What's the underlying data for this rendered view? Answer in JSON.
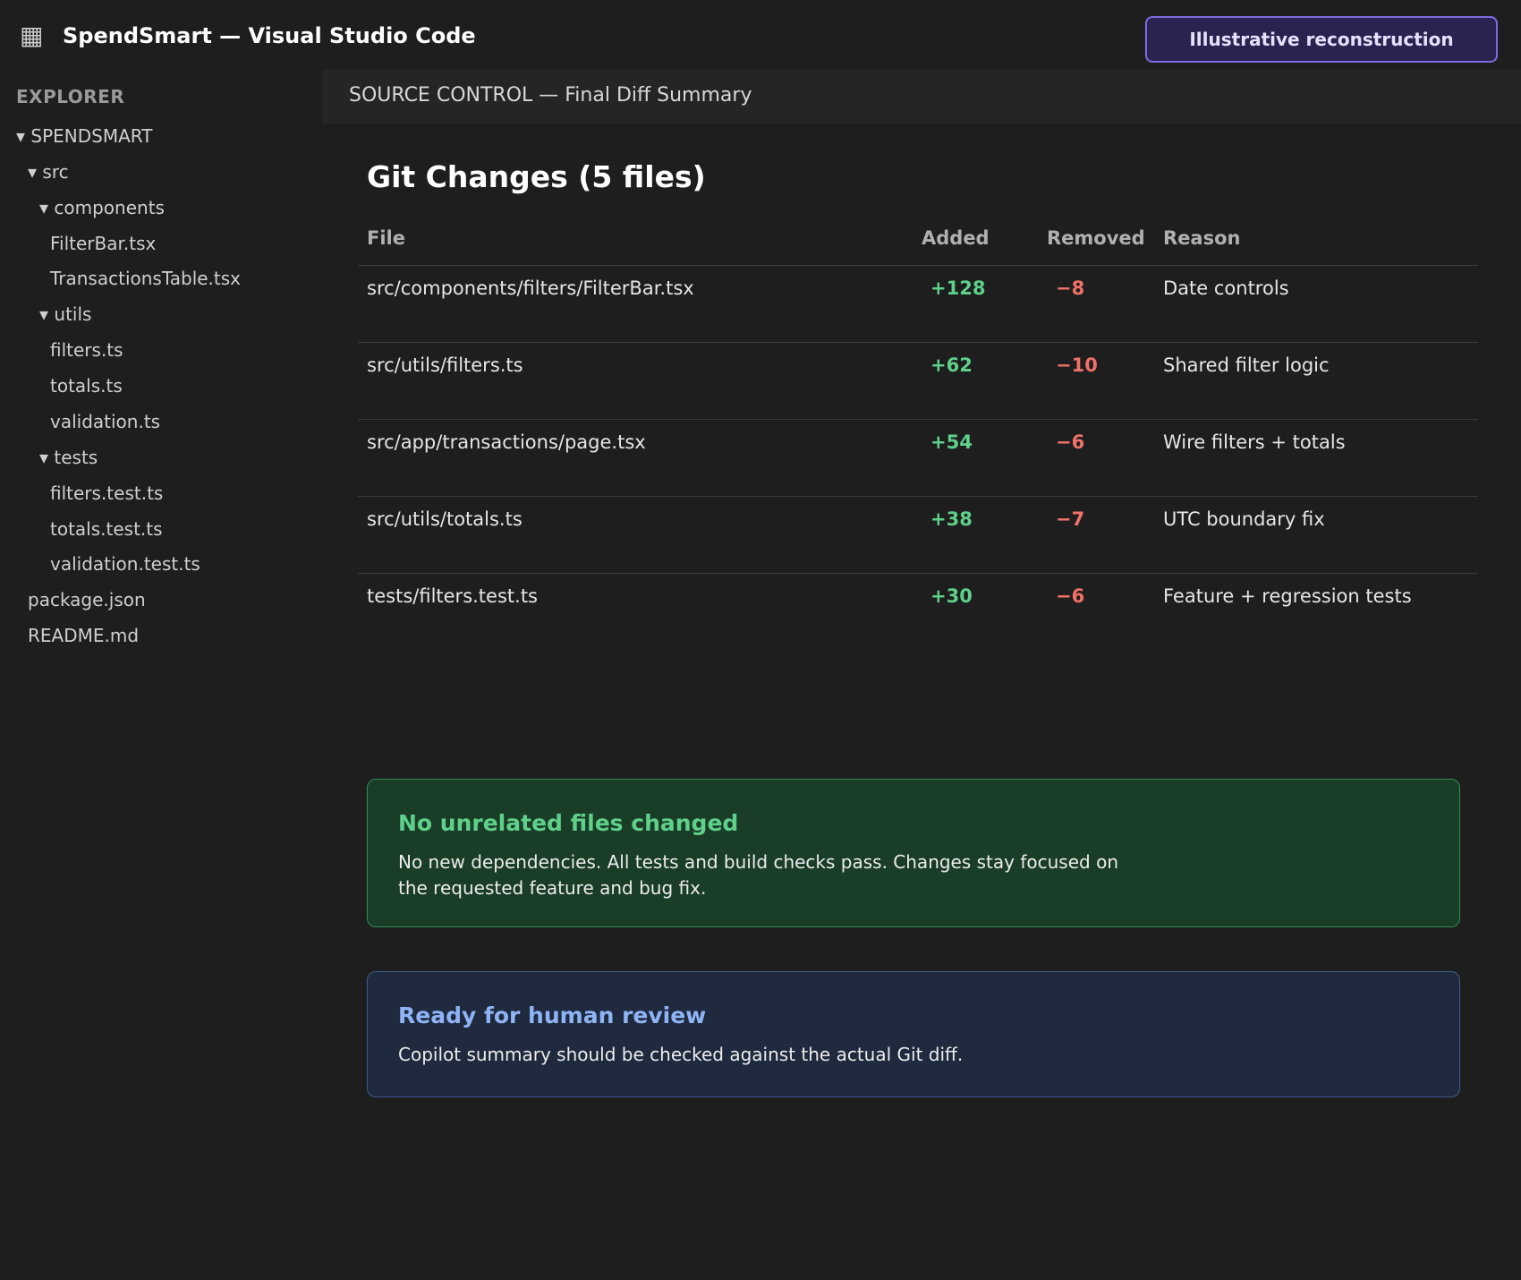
{
  "window": {
    "icon": "grid-icon",
    "title": "SpendSmart — Visual Studio Code",
    "badge": "Illustrative reconstruction"
  },
  "sidebar": {
    "heading": "EXPLORER",
    "tree": [
      {
        "label": "▾ SPENDSMART",
        "depth": 0
      },
      {
        "label": "▾ src",
        "depth": 1
      },
      {
        "label": "▾ components",
        "depth": 2
      },
      {
        "label": "FilterBar.tsx",
        "depth": 3
      },
      {
        "label": "TransactionsTable.tsx",
        "depth": 3
      },
      {
        "label": "▾ utils",
        "depth": 2
      },
      {
        "label": "filters.ts",
        "depth": 3
      },
      {
        "label": "totals.ts",
        "depth": 3
      },
      {
        "label": "validation.ts",
        "depth": 3
      },
      {
        "label": "▾ tests",
        "depth": 2
      },
      {
        "label": "filters.test.ts",
        "depth": 3
      },
      {
        "label": "totals.test.ts",
        "depth": 3
      },
      {
        "label": "validation.test.ts",
        "depth": 3
      },
      {
        "label": "package.json",
        "depth": 1
      },
      {
        "label": "README.md",
        "depth": 1
      }
    ]
  },
  "panel": {
    "title": "SOURCE CONTROL — Final Diff Summary"
  },
  "changes": {
    "heading": "Git Changes (5 files)",
    "columns": {
      "file": "File",
      "added": "Added",
      "removed": "Removed",
      "reason": "Reason"
    },
    "rows": [
      {
        "file": "src/components/filters/FilterBar.tsx",
        "added": "+128",
        "removed": "−8",
        "reason": "Date controls"
      },
      {
        "file": "src/utils/filters.ts",
        "added": "+62",
        "removed": "−10",
        "reason": "Shared filter logic"
      },
      {
        "file": "src/app/transactions/page.tsx",
        "added": "+54",
        "removed": "−6",
        "reason": "Wire filters + totals"
      },
      {
        "file": "src/utils/totals.ts",
        "added": "+38",
        "removed": "−7",
        "reason": "UTC boundary fix"
      },
      {
        "file": "tests/filters.test.ts",
        "added": "+30",
        "removed": "−6",
        "reason": "Feature + regression tests"
      }
    ]
  },
  "cards": {
    "success": {
      "title": "No unrelated files changed",
      "text": "No new dependencies. All tests and build checks pass. Changes stay focused on the requested feature and bug fix."
    },
    "review": {
      "title": "Ready for human review",
      "text": "Copilot summary should be checked against the actual Git diff."
    }
  },
  "colors": {
    "added": "#5fd08a",
    "removed": "#f07167",
    "badge_border": "#7f6ae0",
    "success_bg": "#193d27",
    "review_bg": "#1f2a3f"
  }
}
